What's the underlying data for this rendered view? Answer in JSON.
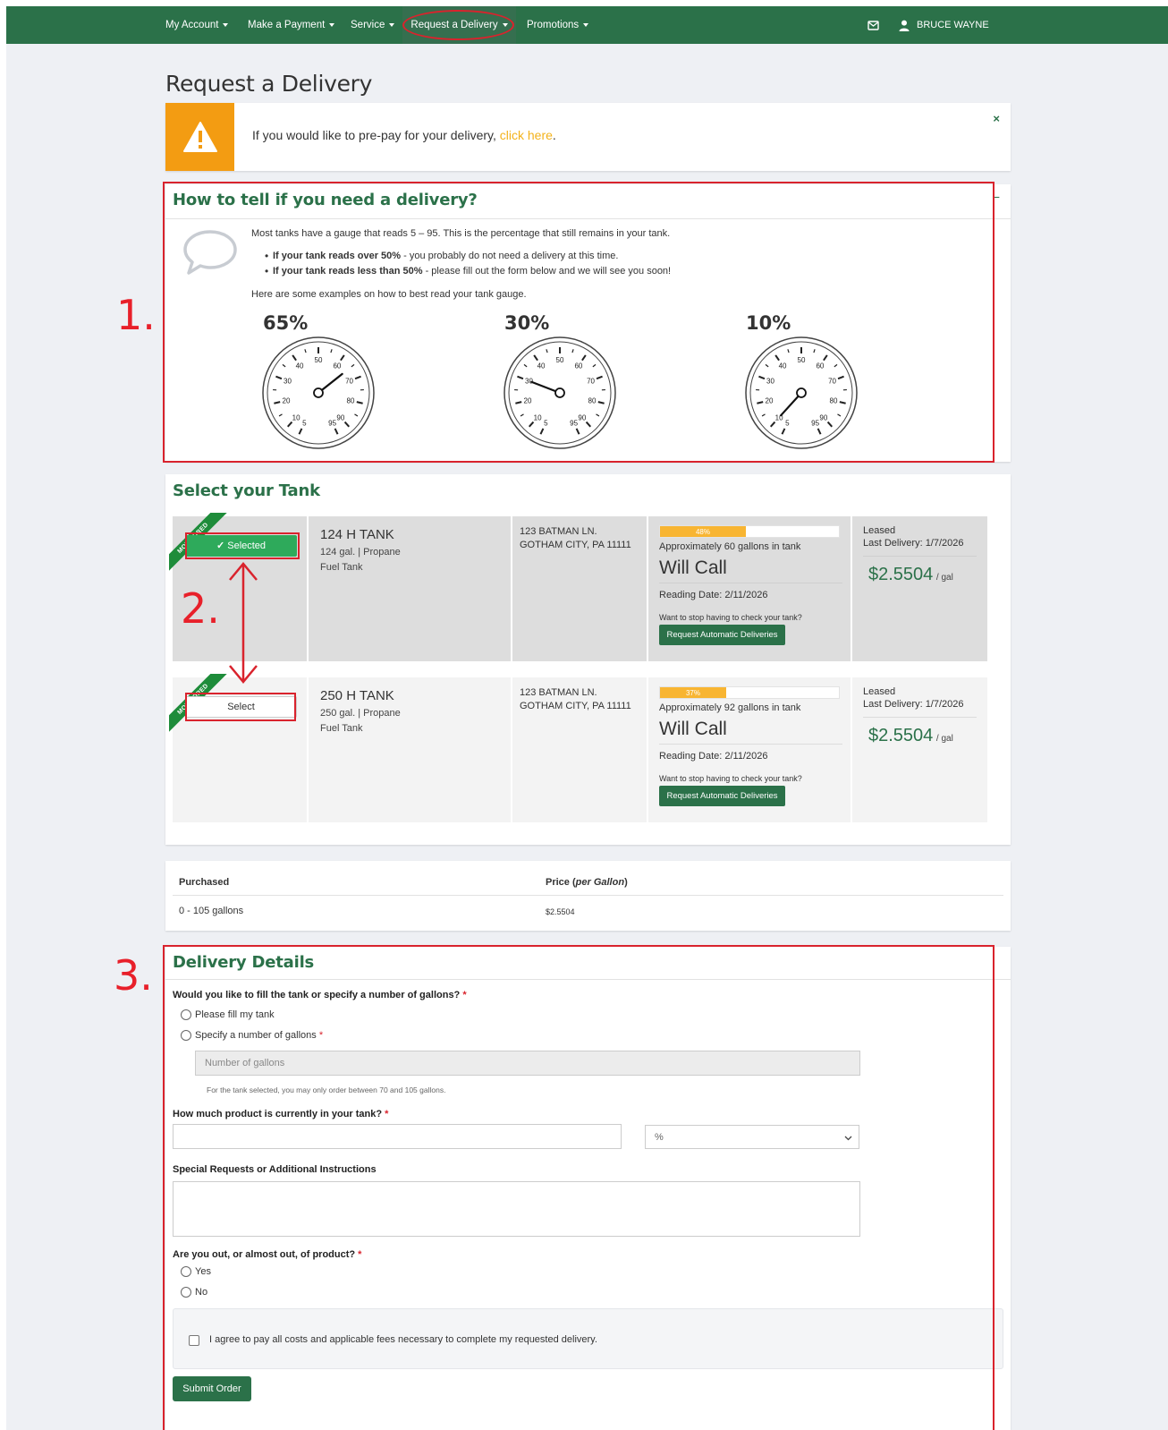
{
  "navbar": {
    "items": [
      {
        "label": "My Account"
      },
      {
        "label": "Make a Payment"
      },
      {
        "label": "Service"
      },
      {
        "label": "Request a Delivery"
      },
      {
        "label": "Promotions"
      }
    ],
    "user_name": "BRUCE WAYNE"
  },
  "page_title": "Request a Delivery",
  "alert": {
    "text": "If you would like to pre-pay for your delivery,",
    "link_text": "click here",
    "suffix": ".",
    "close": "×"
  },
  "how_to": {
    "title": "How to tell if you need a delivery?",
    "collapse": "−",
    "intro": "Most tanks have a gauge that reads 5 – 95. This is the percentage that still remains in your tank.",
    "bullets": [
      {
        "bold": "If your tank reads over 50%",
        "rest": " - you probably do not need a delivery at this time."
      },
      {
        "bold": "If your tank reads less than 50%",
        "rest": " - please fill out the form below and we will see you soon!"
      }
    ],
    "examples_text": "Here are some examples on how to best read your tank gauge.",
    "gauges": [
      {
        "label": "65%",
        "value": 65
      },
      {
        "label": "30%",
        "value": 30
      },
      {
        "label": "10%",
        "value": 10
      }
    ],
    "gauge_ticks": [
      "5",
      "10",
      "20",
      "30",
      "40",
      "50",
      "60",
      "70",
      "80",
      "90",
      "95"
    ]
  },
  "tanks": {
    "title": "Select your Tank",
    "rows": [
      {
        "ribbon": "MONITORED",
        "button": "Selected",
        "name": "124 H TANK",
        "capacity": "124 gal.",
        "fuel": "Propane",
        "type": "Fuel Tank",
        "addr1": "123 BATMAN LN.",
        "addr2": "GOTHAM CITY, PA 11111",
        "percent": 48,
        "percent_label": "48%",
        "gallons_text": "Approximately 60 gallons in tank",
        "status": "Will Call",
        "reading_date": "Reading Date: 2/11/2026",
        "auto_prompt": "Want to stop having to check your tank?",
        "auto_button": "Request Automatic Deliveries",
        "ownership": "Leased",
        "last_delivery": "Last Delivery: 1/7/2026",
        "price": "$2.5504",
        "price_unit": "/ gal"
      },
      {
        "ribbon": "MONITORED",
        "button": "Select",
        "name": "250 H TANK",
        "capacity": "250 gal.",
        "fuel": "Propane",
        "type": "Fuel Tank",
        "addr1": "123 BATMAN LN.",
        "addr2": "GOTHAM CITY, PA 11111",
        "percent": 37,
        "percent_label": "37%",
        "gallons_text": "Approximately 92 gallons in tank",
        "status": "Will Call",
        "reading_date": "Reading Date: 2/11/2026",
        "auto_prompt": "Want to stop having to check your tank?",
        "auto_button": "Request Automatic Deliveries",
        "ownership": "Leased",
        "last_delivery": "Last Delivery: 1/7/2026",
        "price": "$2.5504",
        "price_unit": "/ gal"
      }
    ]
  },
  "pricing": {
    "col1_header": "Purchased",
    "col2_header": "Price",
    "col2_header_em": "per Gallon",
    "rows": [
      {
        "range": "0 - 105 gallons",
        "price": "$2.5504"
      }
    ]
  },
  "delivery": {
    "title": "Delivery Details",
    "q_fill": "Would you like to fill the tank or specify a number of gallons?",
    "opt_fill": "Please fill my tank",
    "opt_specify": "Specify a number of gallons",
    "gallons_placeholder": "Number of gallons",
    "gallons_help": "For the tank selected, you may only order between 70 and 105 gallons.",
    "q_current": "How much product is currently in your tank?",
    "unit_selected": "%",
    "q_special": "Special Requests or Additional Instructions",
    "q_out": "Are you out, or almost out, of product?",
    "opt_yes": "Yes",
    "opt_no": "No",
    "agree": "I agree to pay all costs and applicable fees necessary to complete my requested delivery.",
    "submit": "Submit Order",
    "required_mark": "*"
  },
  "annotations": {
    "one": "1.",
    "two": "2.",
    "three": "3."
  },
  "colors": {
    "brand_green": "#2b7149",
    "annotation_red": "#d9232d",
    "warning_orange": "#f39c12",
    "progress_yellow": "#f8b532"
  }
}
